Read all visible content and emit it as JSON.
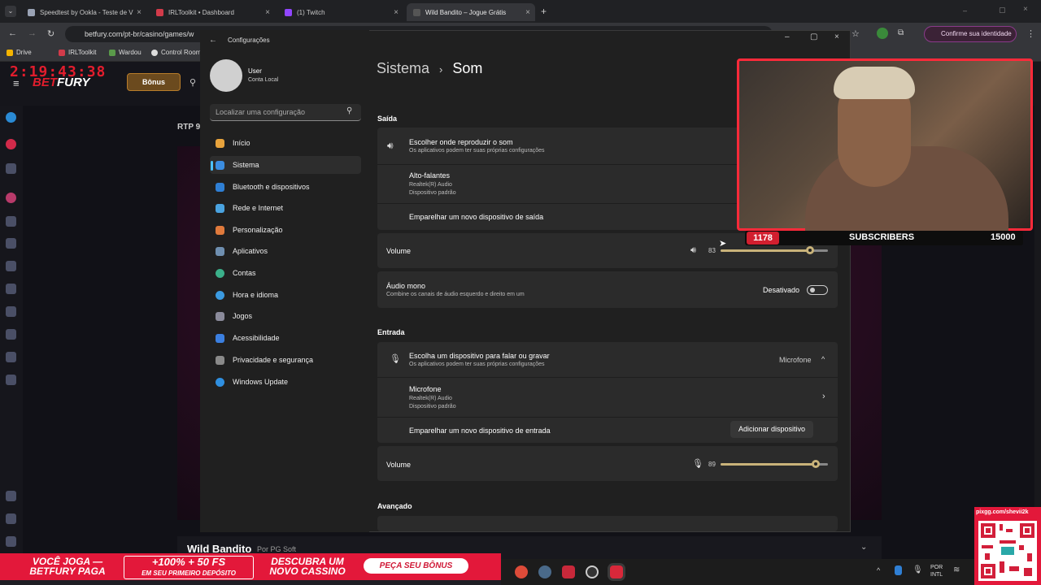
{
  "browser": {
    "tabs": [
      {
        "title": "Speedtest by Ookla - Teste de V",
        "color": "#9aa3b5"
      },
      {
        "title": "IRLToolkit • Dashboard",
        "color": "#d23b4a"
      },
      {
        "title": "(1) Twitch",
        "color": "#9146ff"
      },
      {
        "title": "Wild Bandito – Jogue Grátis",
        "color": "#3a3a3a"
      }
    ],
    "url": "betfury.com/pt-br/casino/games/w",
    "bookmarks": [
      "Drive",
      "IRLToolkit",
      "Wardou",
      "Control Room"
    ],
    "confirm_label": "Confirme sua identidade"
  },
  "betfury": {
    "clock": "2:19:43:38",
    "logo_a": "BET",
    "logo_b": "FURY",
    "bonus": "Bônus",
    "rtp": "RTP 9",
    "game_name": "Wild Bandito",
    "provider": "Por PG Soft"
  },
  "settings": {
    "window_title": "Configurações",
    "user_name": "User",
    "user_account": "Conta Local",
    "search_placeholder": "Localizar uma configuração",
    "nav": [
      {
        "label": "Início",
        "color": "#e8a33c"
      },
      {
        "label": "Sistema",
        "color": "#3b8de0"
      },
      {
        "label": "Bluetooth e dispositivos",
        "color": "#2f7fd4"
      },
      {
        "label": "Rede e Internet",
        "color": "#4aa3e0"
      },
      {
        "label": "Personalização",
        "color": "#e07a3c"
      },
      {
        "label": "Aplicativos",
        "color": "#6f8fb0"
      },
      {
        "label": "Contas",
        "color": "#3bb08a"
      },
      {
        "label": "Hora e idioma",
        "color": "#3b9ae0"
      },
      {
        "label": "Jogos",
        "color": "#8a8a9a"
      },
      {
        "label": "Acessibilidade",
        "color": "#3b7fe0"
      },
      {
        "label": "Privacidade e segurança",
        "color": "#8a8a8a"
      },
      {
        "label": "Windows Update",
        "color": "#2f8fe0"
      }
    ],
    "breadcrumb_parent": "Sistema",
    "breadcrumb_current": "Som",
    "output": {
      "section": "Saída",
      "choose_title": "Escolher onde reproduzir o som",
      "choose_sub": "Os aplicativos podem ter suas próprias configurações",
      "device_name": "Alto-falantes",
      "device_driver": "Realtek(R) Audio",
      "device_default": "Dispositivo padrão",
      "pair_label": "Emparelhar um novo dispositivo de saída",
      "volume_label": "Volume",
      "volume_value": "83",
      "volume_level": 0.83,
      "mono_title": "Áudio mono",
      "mono_sub": "Combine os canais de áudio esquerdo e direito em um",
      "mono_state": "Desativado"
    },
    "input": {
      "section": "Entrada",
      "choose_title": "Escolha um dispositivo para falar ou gravar",
      "choose_sub": "Os aplicativos podem ter suas próprias configurações",
      "selected": "Microfone",
      "device_name": "Microfone",
      "device_driver": "Realtek(R) Audio",
      "device_default": "Dispositivo padrão",
      "pair_label": "Emparelhar um novo dispositivo de entrada",
      "add_button": "Adicionar dispositivo",
      "volume_label": "Volume",
      "volume_value": "89",
      "volume_level": 0.89
    },
    "advanced": "Avançado"
  },
  "stream": {
    "subs": "1178",
    "sub_label": "SUBSCRIBERS",
    "sub_goal": "15000",
    "qr_label": "pixgg.com/shevii2k"
  },
  "promo": {
    "a1": "VOCÊ JOGA —",
    "a2": "BETFURY PAGA",
    "b1": "+100% + 50 FS",
    "b2": "EM SEU PRIMEIRO DEPÓSITO",
    "c1": "DESCUBRA UM",
    "c2": "NOVO CASSINO",
    "button": "PEÇA SEU BÔNUS"
  },
  "taskbar": {
    "lang1": "POR",
    "lang2": "INTL"
  }
}
